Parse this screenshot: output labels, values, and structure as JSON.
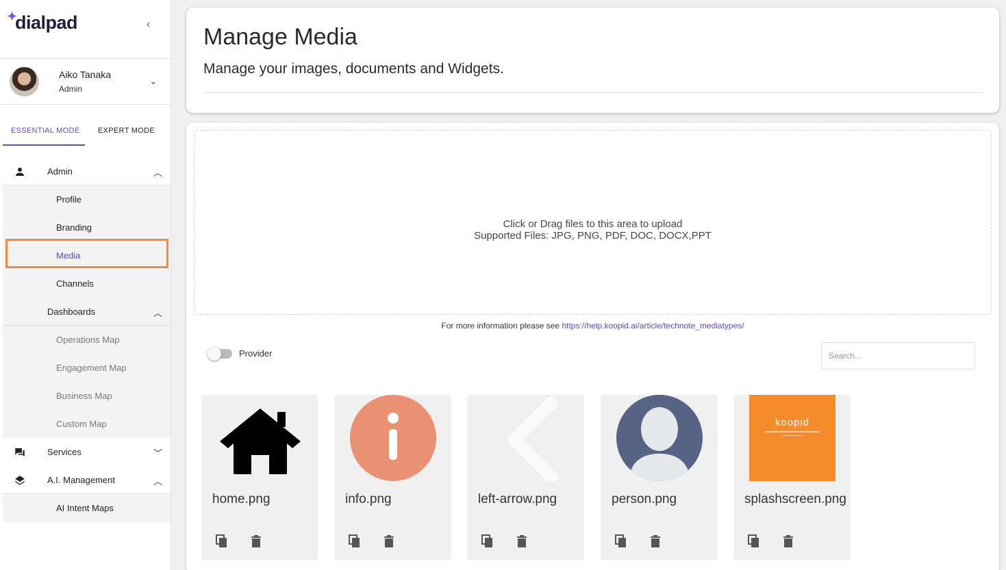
{
  "brand": {
    "logo_text": "dialpad",
    "accent": "#5b45d6",
    "highlight": "#f4883d"
  },
  "user": {
    "name": "Aiko Tanaka",
    "role": "Admin"
  },
  "modes": {
    "essential": "ESSENTIAL MODE",
    "expert": "EXPERT MODE"
  },
  "nav": {
    "admin": "Admin",
    "profile": "Profile",
    "branding": "Branding",
    "media": "Media",
    "channels": "Channels",
    "dashboards": "Dashboards",
    "operations_map": "Operations Map",
    "engagement_map": "Engagement Map",
    "business_map": "Business Map",
    "custom_map": "Custom Map",
    "services": "Services",
    "ai_management": "A.I. Management",
    "ai_intent_maps": "AI Intent Maps"
  },
  "header": {
    "title": "Manage Media",
    "subtitle": "Manage your images, documents and Widgets."
  },
  "upload": {
    "line1": "Click or Drag files to this area to upload",
    "line2": "Supported Files: JPG, PNG, PDF, DOC, DOCX,PPT",
    "info_prefix": "For more information please see ",
    "info_link": "https://help.koopid.ai/article/technote_mediatypes/"
  },
  "filter": {
    "provider_label": "Provider",
    "search_placeholder": "Search..."
  },
  "media": [
    {
      "name": "home.png",
      "icon": "home-icon"
    },
    {
      "name": "info.png",
      "icon": "info-icon"
    },
    {
      "name": "left-arrow.png",
      "icon": "left-arrow-icon"
    },
    {
      "name": "person.png",
      "icon": "person-icon"
    },
    {
      "name": "splashscreen.png",
      "icon": "splash-logo",
      "logo_text": "koopid"
    }
  ]
}
